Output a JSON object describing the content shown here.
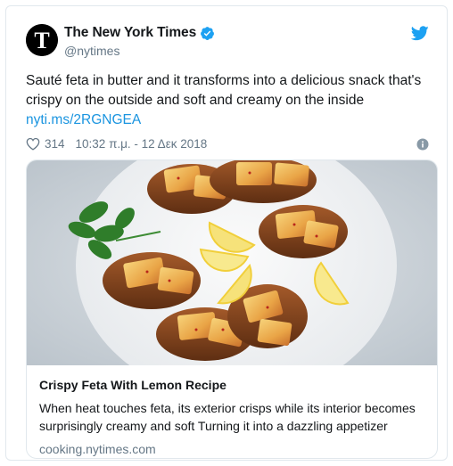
{
  "tweet": {
    "display_name": "The New York Times",
    "handle": "@nytimes",
    "text": "Sauté feta in butter and it transforms into a delicious snack that's crispy on the outside and soft and creamy on the inside",
    "link": "nyti.ms/2RGNGEA",
    "likes": "314",
    "timestamp": "10:32 π.μ. - 12 Δεκ 2018"
  },
  "card": {
    "title": "Crispy Feta With Lemon Recipe",
    "description": "When heat touches feta, its exterior crisps while its interior becomes surprisingly creamy and soft Turning it into a dazzling appetizer",
    "domain": "cooking.nytimes.com"
  },
  "colors": {
    "link": "#1b95e0",
    "secondary_text": "#657786",
    "verified": "#1da1f2",
    "border": "#e1e8ed"
  },
  "icons": [
    "nyt-logo-icon",
    "verified-badge-icon",
    "twitter-bird-icon",
    "heart-icon",
    "info-icon"
  ]
}
